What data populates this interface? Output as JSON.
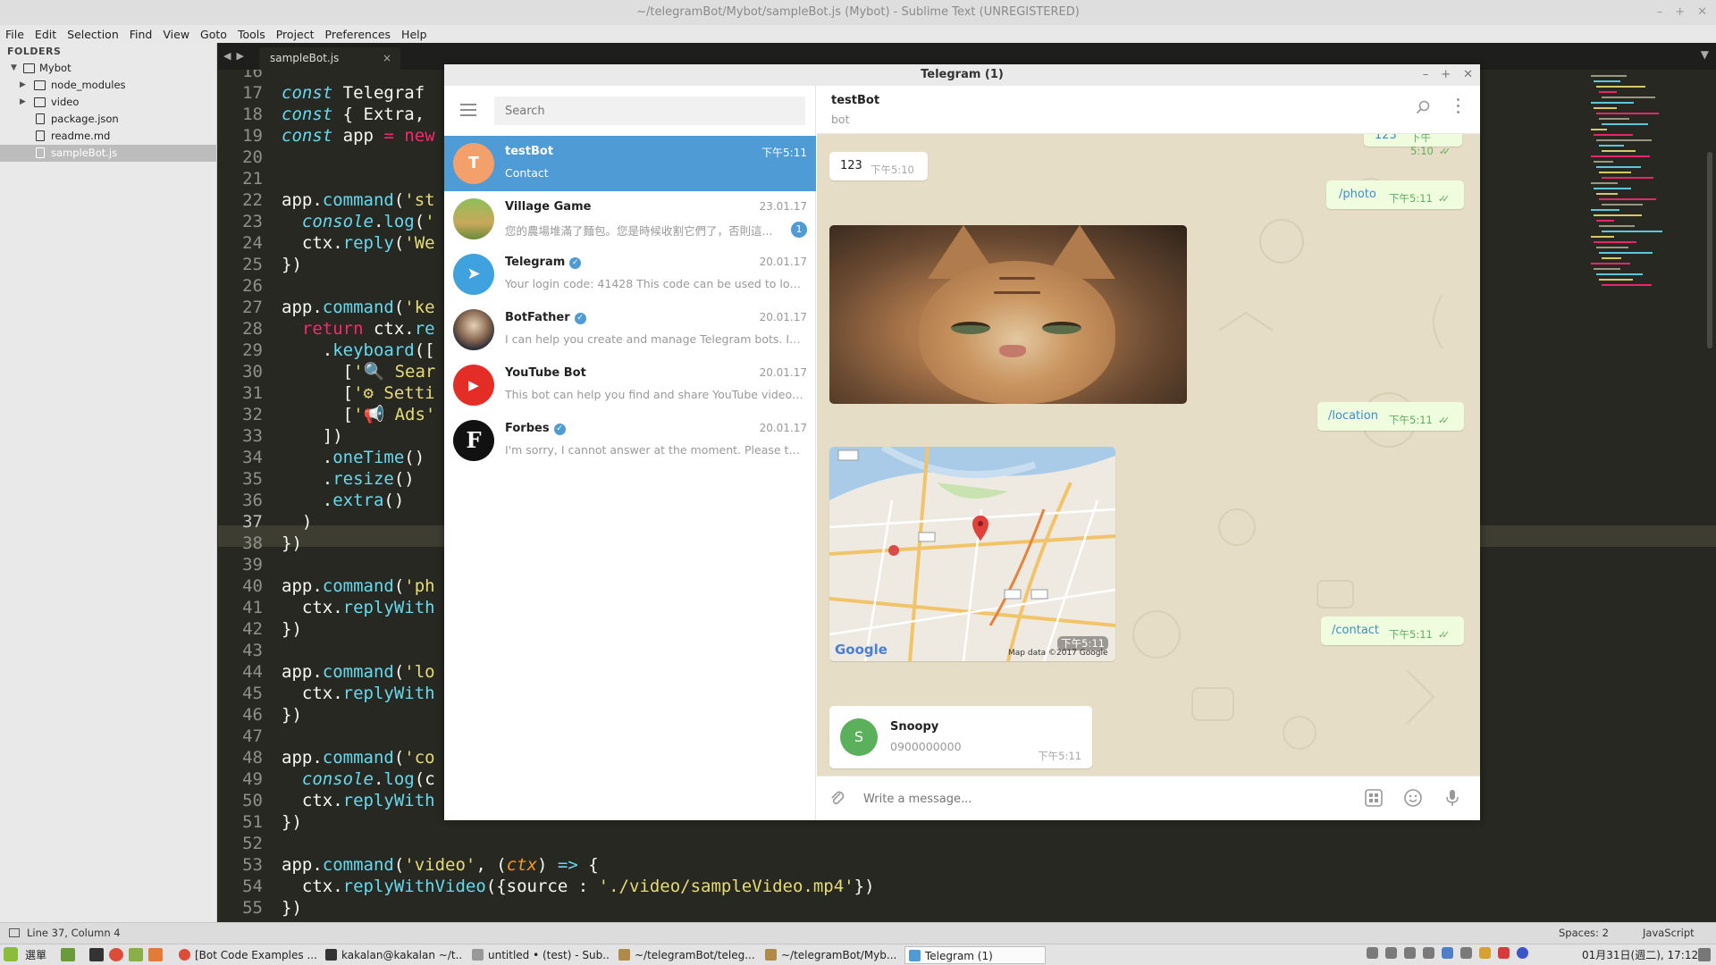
{
  "sublime": {
    "title": "~/telegramBot/Mybot/sampleBot.js (Mybot) - Sublime Text (UNREGISTERED)",
    "menu": [
      "File",
      "Edit",
      "Selection",
      "Find",
      "View",
      "Goto",
      "Tools",
      "Project",
      "Preferences",
      "Help"
    ],
    "sidebar": {
      "header": "FOLDERS",
      "root": "Mybot",
      "items": [
        "node_modules",
        "video",
        "package.json",
        "readme.md",
        "sampleBot.js"
      ]
    },
    "tab": "sampleBot.js",
    "tab_close": "×",
    "line_numbers": [
      "16",
      "17",
      "18",
      "19",
      "20",
      "21",
      "22",
      "23",
      "24",
      "25",
      "26",
      "27",
      "28",
      "29",
      "30",
      "31",
      "32",
      "33",
      "34",
      "35",
      "36",
      "37",
      "38",
      "39",
      "40",
      "41",
      "42",
      "43",
      "44",
      "45",
      "46",
      "47",
      "48",
      "49",
      "50",
      "51",
      "52",
      "53",
      "54",
      "55"
    ],
    "status": {
      "position": "Line 37, Column 4",
      "spaces": "Spaces: 2",
      "syntax": "JavaScript"
    }
  },
  "taskbar": {
    "menu_label": "選單",
    "tasks": [
      "[Bot Code Examples ...",
      "kakalan@kakalan ~/t...",
      "untitled • (test) - Sub...",
      "~/telegramBot/teleg...",
      "~/telegramBot/Myb...",
      "Telegram (1)"
    ],
    "clock": "01月31日(週二), 17:12"
  },
  "telegram": {
    "title": "Telegram (1)",
    "search_placeholder": "Search",
    "chats": [
      {
        "initial": "T",
        "name": "testBot",
        "time": "下午5:11",
        "preview": "Contact"
      },
      {
        "name": "Village Game",
        "time": "23.01.17",
        "preview": "您的農場堆滿了麵包。您是時候收割它們了，否則這...",
        "unread": "1"
      },
      {
        "name": "Telegram",
        "time": "20.01.17",
        "preview": "Your login code: 41428  This code can be used to log i..."
      },
      {
        "name": "BotFather",
        "time": "20.01.17",
        "preview": "I can help you create and manage Telegram bots. If y..."
      },
      {
        "name": "YouTube Bot",
        "time": "20.01.17",
        "preview": "This bot can help you find and share YouTube videos. ..."
      },
      {
        "initial": "F",
        "name": "Forbes",
        "time": "20.01.17",
        "preview": "I'm sorry, I cannot answer at the moment. Please try a..."
      }
    ],
    "header": {
      "name": "testBot",
      "status": "bot"
    },
    "messages": {
      "m0": {
        "text": "123",
        "time": "下午5:10"
      },
      "m1": {
        "text": "123",
        "time": "下午5:10"
      },
      "m2": {
        "text": "/photo",
        "time": "下午5:11"
      },
      "m3": {
        "text": "/location",
        "time": "下午5:11"
      },
      "map": {
        "time": "下午5:11",
        "google": "Google",
        "credit": "Map data ©2017 Google"
      },
      "m4": {
        "text": "/contact",
        "time": "下午5:11"
      },
      "contact": {
        "initial": "S",
        "name": "Snoopy",
        "phone": "0900000000",
        "time": "下午5:11"
      }
    },
    "input_placeholder": "Write a message..."
  },
  "colors": {
    "accent": "#4f9bd6",
    "chat_bg": "#e5ddc6",
    "editor_bg": "#272822"
  }
}
